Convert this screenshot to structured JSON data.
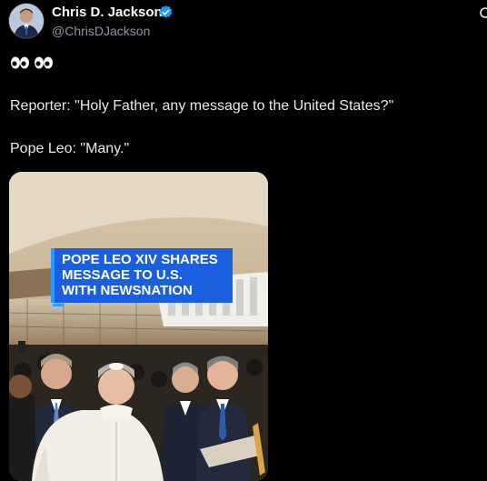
{
  "author": {
    "display_name": "Chris D. Jackson",
    "handle": "@ChrisDJackson",
    "verified": true
  },
  "post": {
    "emoji": "👀 👀",
    "line1": "Reporter: \"Holy Father, any message to the United States?\"",
    "line2": "Pope Leo: \"Many.\""
  },
  "media": {
    "headline_lines": [
      "POPE LEO XIV SHARES",
      "MESSAGE TO U.S.",
      "WITH NEWSNATION"
    ]
  },
  "colors": {
    "background": "#000000",
    "text": "#e7e9ea",
    "secondary_text": "#8b98a5",
    "verified_badge": "#1d9bf0",
    "headline_banner": "#1a5fe0"
  },
  "icons": {
    "verified": "verified-badge-icon",
    "more": "grok-icon",
    "eyes": "eyes-emoji-icon"
  }
}
